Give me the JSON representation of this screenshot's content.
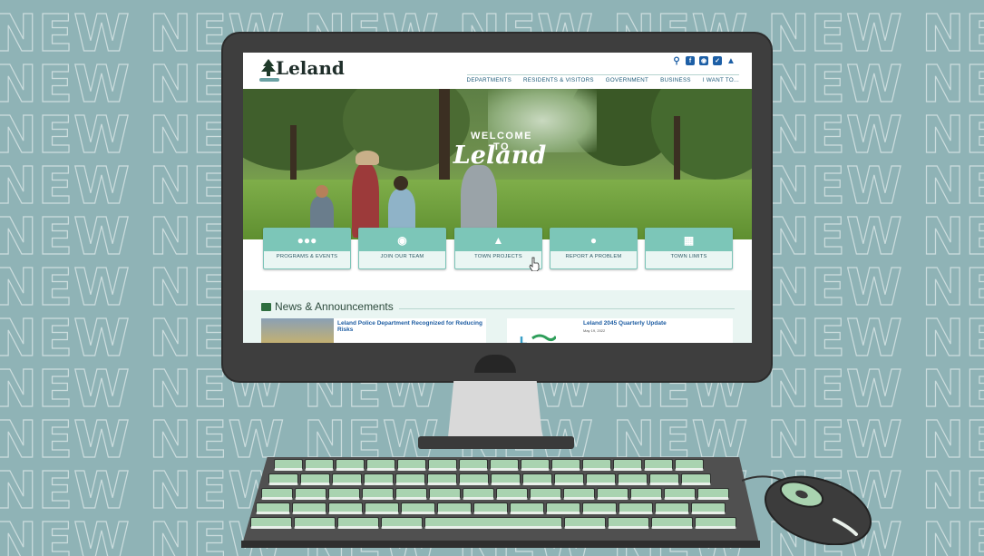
{
  "background": {
    "pattern_word": "NEW",
    "color": "#8fb3b6"
  },
  "site": {
    "logo_text": "Leland",
    "utility_icons": [
      "search-icon",
      "facebook-icon",
      "instagram-icon",
      "twitter-icon",
      "alert-icon"
    ],
    "nav": [
      "DEPARTMENTS",
      "RESIDENTS & VISITORS",
      "GOVERNMENT",
      "BUSINESS",
      "I WANT TO..."
    ],
    "hero": {
      "welcome_small": "WELCOME TO",
      "welcome_script": "Leland"
    },
    "quick_links": [
      {
        "label": "PROGRAMS & EVENTS",
        "icon": "people-icon"
      },
      {
        "label": "JOIN OUR TEAM",
        "icon": "handshake-icon"
      },
      {
        "label": "TOWN PROJECTS",
        "icon": "cone-icon"
      },
      {
        "label": "REPORT A PROBLEM",
        "icon": "map-pin-icon"
      },
      {
        "label": "TOWN LIMITS",
        "icon": "map-icon"
      }
    ],
    "news": {
      "title": "News & Announcements",
      "items": [
        {
          "headline": "Leland Police Department Recognized for Reducing Risks",
          "date": ""
        },
        {
          "headline": "Leland 2045 Quarterly Update",
          "date": "May 19, 2022"
        }
      ]
    },
    "accent": "#7cc6b8"
  }
}
